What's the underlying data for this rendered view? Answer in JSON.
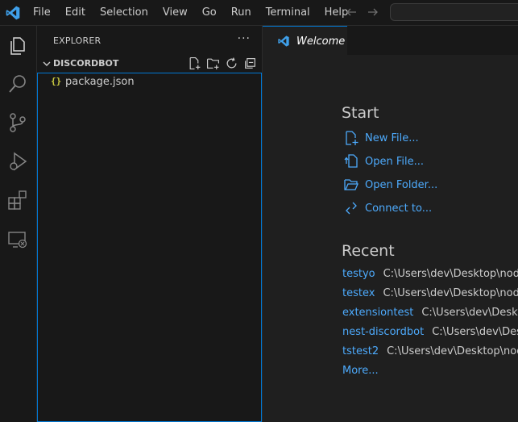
{
  "menu": [
    "File",
    "Edit",
    "Selection",
    "View",
    "Go",
    "Run",
    "Terminal",
    "Help"
  ],
  "sidebar": {
    "title": "EXPLORER",
    "more": "···",
    "section": "DISCORDBOT",
    "files": [
      {
        "name": "package.json",
        "icon": "{}"
      }
    ]
  },
  "tab": {
    "label": "Welcome"
  },
  "welcome": {
    "start_heading": "Start",
    "start_items": [
      {
        "label": "New File...",
        "icon": "new-file-icon"
      },
      {
        "label": "Open File...",
        "icon": "open-file-icon"
      },
      {
        "label": "Open Folder...",
        "icon": "open-folder-icon"
      },
      {
        "label": "Connect to...",
        "icon": "remote-connect-icon"
      }
    ],
    "recent_heading": "Recent",
    "recent": [
      {
        "name": "testyo",
        "path": "C:\\Users\\dev\\Desktop\\node_t"
      },
      {
        "name": "testex",
        "path": "C:\\Users\\dev\\Desktop\\node_t"
      },
      {
        "name": "extensiontest",
        "path": "C:\\Users\\dev\\Desktop\\"
      },
      {
        "name": "nest-discordbot",
        "path": "C:\\Users\\dev\\Deskt"
      },
      {
        "name": "tstest2",
        "path": "C:\\Users\\dev\\Desktop\\node_"
      }
    ],
    "more": "More..."
  },
  "colors": {
    "accent": "#0078d4",
    "link": "#4daafc",
    "json_icon": "#cbcb41",
    "background": "#1f1f1f",
    "sidebar_background": "#181818"
  }
}
